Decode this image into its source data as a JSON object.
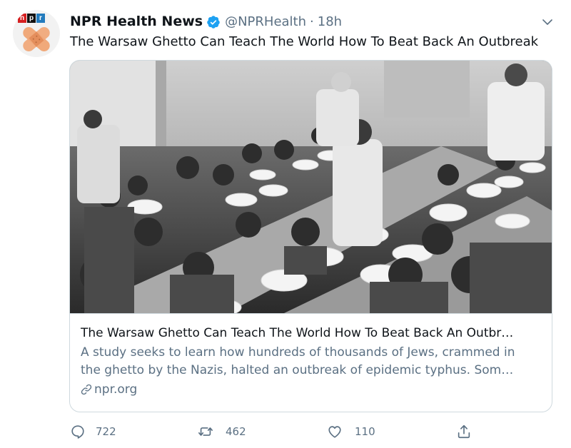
{
  "author": {
    "name": "NPR Health News",
    "handle": "@NPRHealth",
    "separator": "·",
    "time": "18h",
    "logo_letters": [
      "n",
      "p",
      "r"
    ]
  },
  "tweet_text": "The Warsaw Ghetto Can Teach The World How To Beat Back An Outbreak",
  "card": {
    "title": "The Warsaw Ghetto Can Teach The World How To Beat Back An Outbr…",
    "description_line1": "A study seeks to learn how hundreds of thousands of Jews, crammed in",
    "description_line2": "the ghetto by the Nazis, halted an outbreak of epidemic typhus. Som…",
    "link": "npr.org"
  },
  "actions": {
    "replies": "722",
    "retweets": "462",
    "likes": "110"
  },
  "icons": [
    "verified-icon",
    "chevron-down-icon",
    "reply-icon",
    "retweet-icon",
    "like-icon",
    "share-icon",
    "link-icon"
  ],
  "colors": {
    "verified_blue": "#1da1f2",
    "secondary_text": "#5b7083",
    "primary_text": "#0f1419",
    "border": "#cfd9de"
  }
}
